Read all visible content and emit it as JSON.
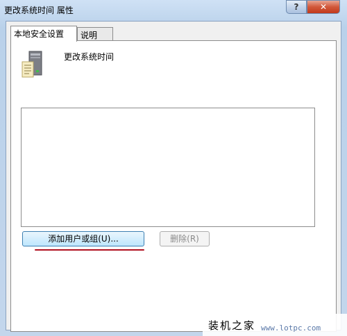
{
  "window": {
    "title": "更改系统时间 属性",
    "help_label": "?",
    "close_label": "✕"
  },
  "tabs": [
    {
      "label": "本地安全设置",
      "active": true
    },
    {
      "label": "说明",
      "active": false
    }
  ],
  "policy": {
    "name": "更改系统时间",
    "icon": "server-document-icon"
  },
  "list": {
    "items": []
  },
  "buttons": {
    "add_label": "添加用户或组(U)...",
    "remove_label": "删除(R)"
  },
  "watermark": {
    "text": "装机之家",
    "url": "www.lotpc.com"
  },
  "colors": {
    "underline": "#b01020",
    "close_button": "#c23a1c"
  }
}
